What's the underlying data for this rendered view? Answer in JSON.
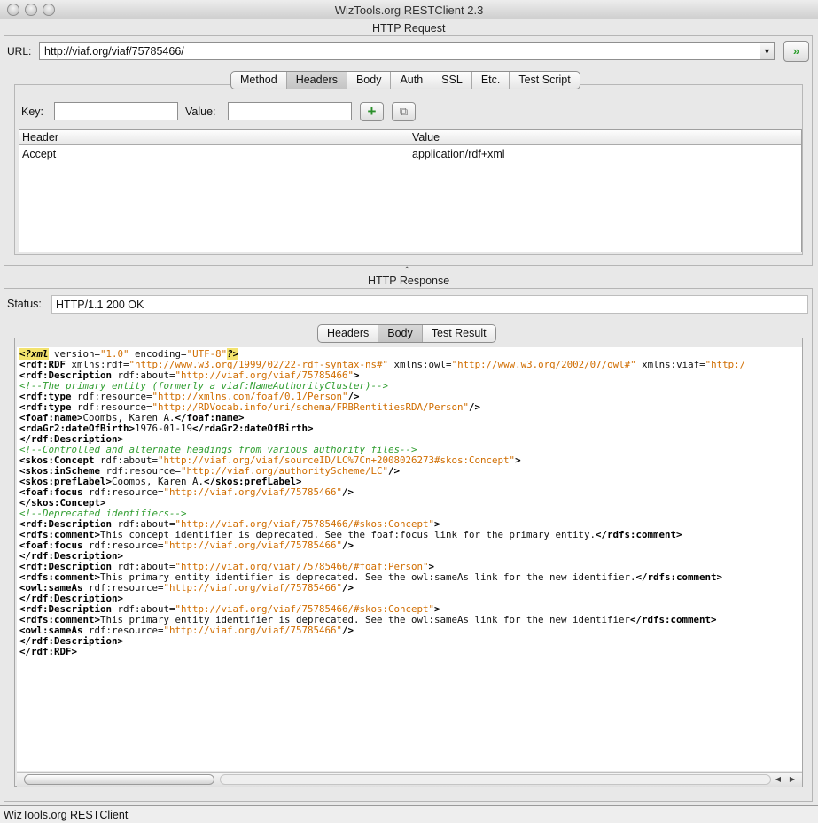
{
  "window": {
    "title": "WizTools.org RESTClient 2.3"
  },
  "request": {
    "section_label": "HTTP Request",
    "url_label": "URL:",
    "url_value": "http://viaf.org/viaf/75785466/",
    "dropdown_glyph": "▼",
    "go_glyph": "»",
    "tabs": [
      "Method",
      "Headers",
      "Body",
      "Auth",
      "SSL",
      "Etc.",
      "Test Script"
    ],
    "active_tab": "Headers",
    "key_label": "Key:",
    "key_value": "",
    "value_label": "Value:",
    "value_value": "",
    "add_glyph": "+",
    "copy_glyph": "⧉",
    "headers_table": {
      "columns": [
        "Header",
        "Value"
      ],
      "rows": [
        {
          "header": "Accept",
          "value": "application/rdf+xml"
        }
      ]
    }
  },
  "response": {
    "section_label": "HTTP Response",
    "status_label": "Status:",
    "status_value": "HTTP/1.1 200 OK",
    "tabs": [
      "Headers",
      "Body",
      "Test Result"
    ],
    "active_tab": "Body",
    "body_lines": [
      [
        [
          "pi",
          "<?xml"
        ],
        [
          "attr",
          " version="
        ],
        [
          "val",
          "\"1.0\""
        ],
        [
          "attr",
          " encoding="
        ],
        [
          "val",
          "\"UTF-8\""
        ],
        [
          "pi",
          "?>"
        ]
      ],
      [
        [
          "tag",
          "<rdf:RDF"
        ],
        [
          "attr",
          " xmlns:rdf="
        ],
        [
          "val",
          "\"http://www.w3.org/1999/02/22-rdf-syntax-ns#\""
        ],
        [
          "attr",
          " xmlns:owl="
        ],
        [
          "val",
          "\"http://www.w3.org/2002/07/owl#\""
        ],
        [
          "attr",
          " xmlns:viaf="
        ],
        [
          "val",
          "\"http:/"
        ]
      ],
      [
        [
          "tag",
          "<rdf:Description"
        ],
        [
          "attr",
          " rdf:about="
        ],
        [
          "val",
          "\"http://viaf.org/viaf/75785466\""
        ],
        [
          "tag",
          ">"
        ]
      ],
      [
        [
          "comment",
          "<!--The primary entity (formerly a viaf:NameAuthorityCluster)-->"
        ]
      ],
      [
        [
          "tag",
          "<rdf:type"
        ],
        [
          "attr",
          " rdf:resource="
        ],
        [
          "val",
          "\"http://xmlns.com/foaf/0.1/Person\""
        ],
        [
          "tag",
          "/>"
        ]
      ],
      [
        [
          "tag",
          "<rdf:type"
        ],
        [
          "attr",
          " rdf:resource="
        ],
        [
          "val",
          "\"http://RDVocab.info/uri/schema/FRBRentitiesRDA/Person\""
        ],
        [
          "tag",
          "/>"
        ]
      ],
      [
        [
          "tag",
          "<foaf:name>"
        ],
        [
          "attr",
          "Coombs, Karen A."
        ],
        [
          "tag",
          "</foaf:name>"
        ]
      ],
      [
        [
          "tag",
          "<rdaGr2:dateOfBirth>"
        ],
        [
          "attr",
          "1976-01-19"
        ],
        [
          "tag",
          "</rdaGr2:dateOfBirth>"
        ]
      ],
      [
        [
          "tag",
          "</rdf:Description>"
        ]
      ],
      [
        [
          "comment",
          "<!--Controlled and alternate headings from various authority files-->"
        ]
      ],
      [
        [
          "tag",
          "<skos:Concept"
        ],
        [
          "attr",
          " rdf:about="
        ],
        [
          "val",
          "\"http://viaf.org/viaf/sourceID/LC%7Cn+2008026273#skos:Concept\""
        ],
        [
          "tag",
          ">"
        ]
      ],
      [
        [
          "tag",
          "<skos:inScheme"
        ],
        [
          "attr",
          " rdf:resource="
        ],
        [
          "val",
          "\"http://viaf.org/authorityScheme/LC\""
        ],
        [
          "tag",
          "/>"
        ]
      ],
      [
        [
          "tag",
          "<skos:prefLabel>"
        ],
        [
          "attr",
          "Coombs, Karen A."
        ],
        [
          "tag",
          "</skos:prefLabel>"
        ]
      ],
      [
        [
          "tag",
          "<foaf:focus"
        ],
        [
          "attr",
          " rdf:resource="
        ],
        [
          "val",
          "\"http://viaf.org/viaf/75785466\""
        ],
        [
          "tag",
          "/>"
        ]
      ],
      [
        [
          "tag",
          "</skos:Concept>"
        ]
      ],
      [
        [
          "comment",
          "<!--Deprecated identifiers-->"
        ]
      ],
      [
        [
          "tag",
          "<rdf:Description"
        ],
        [
          "attr",
          " rdf:about="
        ],
        [
          "val",
          "\"http://viaf.org/viaf/75785466/#skos:Concept\""
        ],
        [
          "tag",
          ">"
        ]
      ],
      [
        [
          "tag",
          "<rdfs:comment>"
        ],
        [
          "attr",
          "This concept identifier is deprecated. See the foaf:focus link for the primary entity."
        ],
        [
          "tag",
          "</rdfs:comment>"
        ]
      ],
      [
        [
          "tag",
          "<foaf:focus"
        ],
        [
          "attr",
          " rdf:resource="
        ],
        [
          "val",
          "\"http://viaf.org/viaf/75785466\""
        ],
        [
          "tag",
          "/>"
        ]
      ],
      [
        [
          "tag",
          "</rdf:Description>"
        ]
      ],
      [
        [
          "tag",
          "<rdf:Description"
        ],
        [
          "attr",
          " rdf:about="
        ],
        [
          "val",
          "\"http://viaf.org/viaf/75785466/#foaf:Person\""
        ],
        [
          "tag",
          ">"
        ]
      ],
      [
        [
          "tag",
          "<rdfs:comment>"
        ],
        [
          "attr",
          "This primary entity identifier is deprecated. See the owl:sameAs link for the new identifier."
        ],
        [
          "tag",
          "</rdfs:comment>"
        ]
      ],
      [
        [
          "tag",
          "<owl:sameAs"
        ],
        [
          "attr",
          " rdf:resource="
        ],
        [
          "val",
          "\"http://viaf.org/viaf/75785466\""
        ],
        [
          "tag",
          "/>"
        ]
      ],
      [
        [
          "tag",
          "</rdf:Description>"
        ]
      ],
      [
        [
          "tag",
          "<rdf:Description"
        ],
        [
          "attr",
          " rdf:about="
        ],
        [
          "val",
          "\"http://viaf.org/viaf/75785466/#skos:Concept\""
        ],
        [
          "tag",
          ">"
        ]
      ],
      [
        [
          "tag",
          "<rdfs:comment>"
        ],
        [
          "attr",
          "This primary entity identifier is deprecated. See the owl:sameAs link for the new identifier"
        ],
        [
          "tag",
          "</rdfs:comment>"
        ]
      ],
      [
        [
          "tag",
          "<owl:sameAs"
        ],
        [
          "attr",
          " rdf:resource="
        ],
        [
          "val",
          "\"http://viaf.org/viaf/75785466\""
        ],
        [
          "tag",
          "/>"
        ]
      ],
      [
        [
          "tag",
          "</rdf:Description>"
        ]
      ],
      [
        [
          "tag",
          "</rdf:RDF>"
        ]
      ]
    ]
  },
  "statusbar": {
    "text": "WizTools.org RESTClient"
  },
  "colors": {
    "xml_value": "#d06d00",
    "xml_comment": "#2f9d2f",
    "xml_pi_highlight": "#f3e36e",
    "go_green": "#2f9e2f"
  },
  "icons": {
    "go": "double-chevron-right-icon",
    "add": "plus-icon",
    "copy": "copy-icon",
    "dropdown": "chevron-down-icon"
  }
}
